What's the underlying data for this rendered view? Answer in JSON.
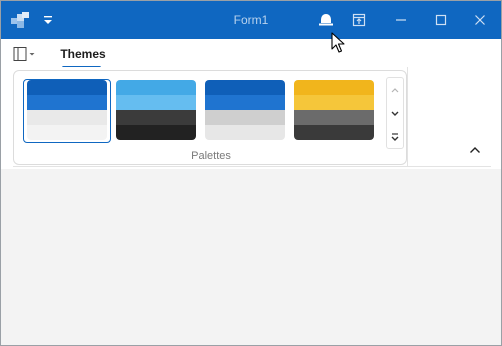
{
  "window": {
    "title": "Form1",
    "titlebar_color": "#0f67c1"
  },
  "qat": {
    "icon": "chevron-down-icon"
  },
  "title_buttons": [
    {
      "name": "bell-icon"
    },
    {
      "name": "restore-ribbon-icon"
    },
    {
      "name": "minimize-icon"
    },
    {
      "name": "maximize-icon"
    },
    {
      "name": "close-icon"
    }
  ],
  "ribbon": {
    "app_menu_icon": "layout-panel-icon",
    "tabs": [
      {
        "label": "Themes",
        "selected": true
      }
    ],
    "group": {
      "label": "Palettes",
      "selected_index": 0,
      "palettes": [
        {
          "bands": [
            "#0f5fb8",
            "#1f74d0",
            "#e9e9e9",
            "#f3f3f3"
          ]
        },
        {
          "bands": [
            "#43a9e6",
            "#65bdf0",
            "#3b3b3b",
            "#222222"
          ]
        },
        {
          "bands": [
            "#0f5fb8",
            "#1f74d0",
            "#cfcfcf",
            "#e7e7e7"
          ]
        },
        {
          "bands": [
            "#f1b51c",
            "#f5c63a",
            "#6b6b6b",
            "#3a3a3a"
          ]
        }
      ]
    }
  }
}
